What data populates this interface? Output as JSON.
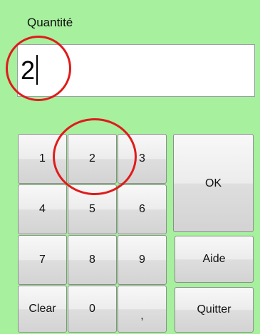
{
  "form": {
    "quantity_label": "Quantité",
    "quantity_value": "2"
  },
  "keypad": {
    "keys": {
      "k1": "1",
      "k2": "2",
      "k3": "3",
      "k4": "4",
      "k5": "5",
      "k6": "6",
      "k7": "7",
      "k8": "8",
      "k9": "9",
      "clear": "Clear",
      "k0": "0",
      "comma": ","
    },
    "ok_label": "OK",
    "help_label": "Aide",
    "quit_label": "Quitter"
  },
  "annotations": {
    "highlight_color": "#e01b1b"
  }
}
